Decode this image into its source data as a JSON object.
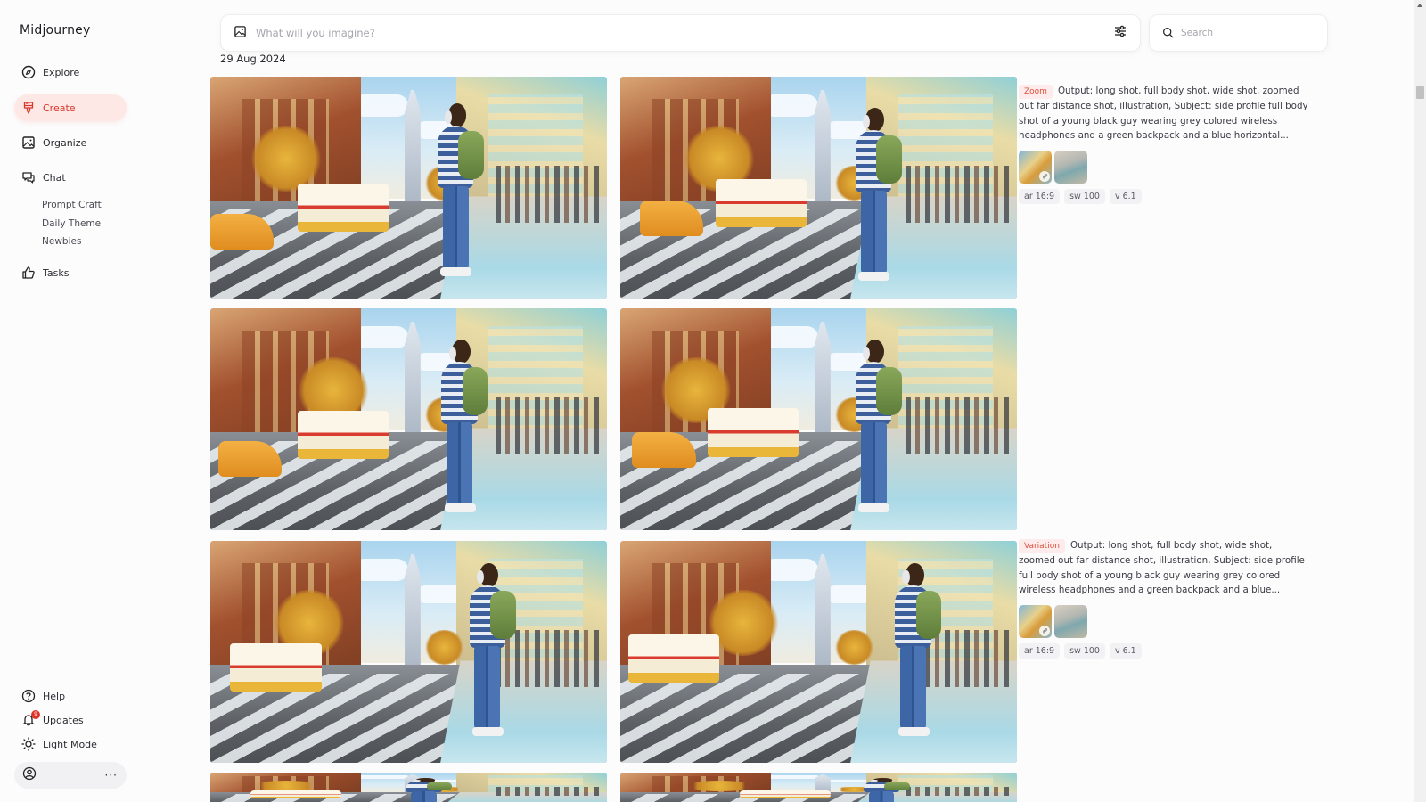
{
  "app": {
    "brand": "Midjourney"
  },
  "sidebar": {
    "items": [
      {
        "label": "Explore",
        "icon": "compass-icon"
      },
      {
        "label": "Create",
        "icon": "paintbrush-icon",
        "active": true
      },
      {
        "label": "Organize",
        "icon": "image-icon"
      },
      {
        "label": "Chat",
        "icon": "chat-bubbles-icon"
      }
    ],
    "chat_rooms": [
      "Prompt Craft",
      "Daily Theme",
      "Newbies"
    ],
    "tasks": {
      "label": "Tasks",
      "icon": "thumbs-up-icon"
    },
    "bottom": [
      {
        "label": "Help",
        "icon": "help-circle-icon"
      },
      {
        "label": "Updates",
        "icon": "bell-icon",
        "badge": "9"
      },
      {
        "label": "Light Mode",
        "icon": "sun-icon"
      }
    ],
    "account": {
      "icon": "user-circle-icon",
      "more": "···"
    }
  },
  "prompt_bar": {
    "placeholder": "What will you imagine?",
    "value": ""
  },
  "search": {
    "placeholder": "Search",
    "value": ""
  },
  "feed": {
    "date": "29 Aug 2024",
    "jobs": [
      {
        "type": "Zoom",
        "prompt": "Output: long shot, full body shot, wide shot, zoomed out far distance shot, illustration, Subject: side profile full body shot of a young black guy wearing grey colored wireless headphones and a green backpack and a blue horizontal...",
        "params": [
          "ar 16:9",
          "sw 100",
          "v 6.1"
        ],
        "images": 4
      },
      {
        "type": "Variation",
        "prompt": "Output: long shot, full body shot, wide shot, zoomed out far distance shot, illustration, Subject: side profile full body shot of a young black guy wearing grey colored wireless headphones and a green backpack and a blue...",
        "params": [
          "ar 16:9",
          "sw 100",
          "v 6.1"
        ],
        "images": 4
      }
    ]
  },
  "colors": {
    "accent": "#d9362b",
    "accent_bg": "#fde8e6",
    "tag_text": "#e0533f",
    "tag_bg": "#fdeceb",
    "badge": "#e0342a"
  }
}
